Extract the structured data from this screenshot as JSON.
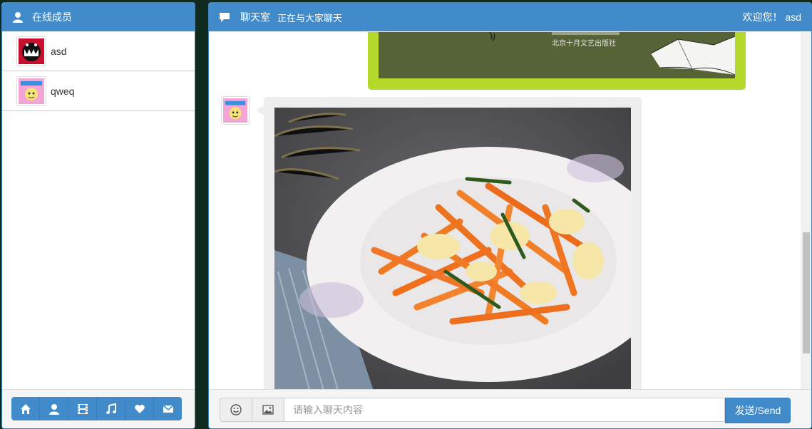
{
  "members_panel": {
    "title": "在线成员",
    "members": [
      {
        "name": "asd"
      },
      {
        "name": "qweq"
      }
    ],
    "toolbar": [
      {
        "icon": "home-icon"
      },
      {
        "icon": "user-icon"
      },
      {
        "icon": "film-icon"
      },
      {
        "icon": "music-icon"
      },
      {
        "icon": "heart-icon"
      },
      {
        "icon": "envelope-icon"
      }
    ]
  },
  "chat_panel": {
    "title": "聊天室",
    "subtitle": "正在与大家聊天",
    "welcome": "欢迎您！ asd",
    "previous_image_caption": "北京十月文艺出版社",
    "input_placeholder": "请输入聊天内容",
    "send_label": "发送/Send"
  },
  "colors": {
    "header": "#428bca",
    "image_bubble_border": "#b5d82c",
    "image_bubble_bg": "#566337"
  }
}
